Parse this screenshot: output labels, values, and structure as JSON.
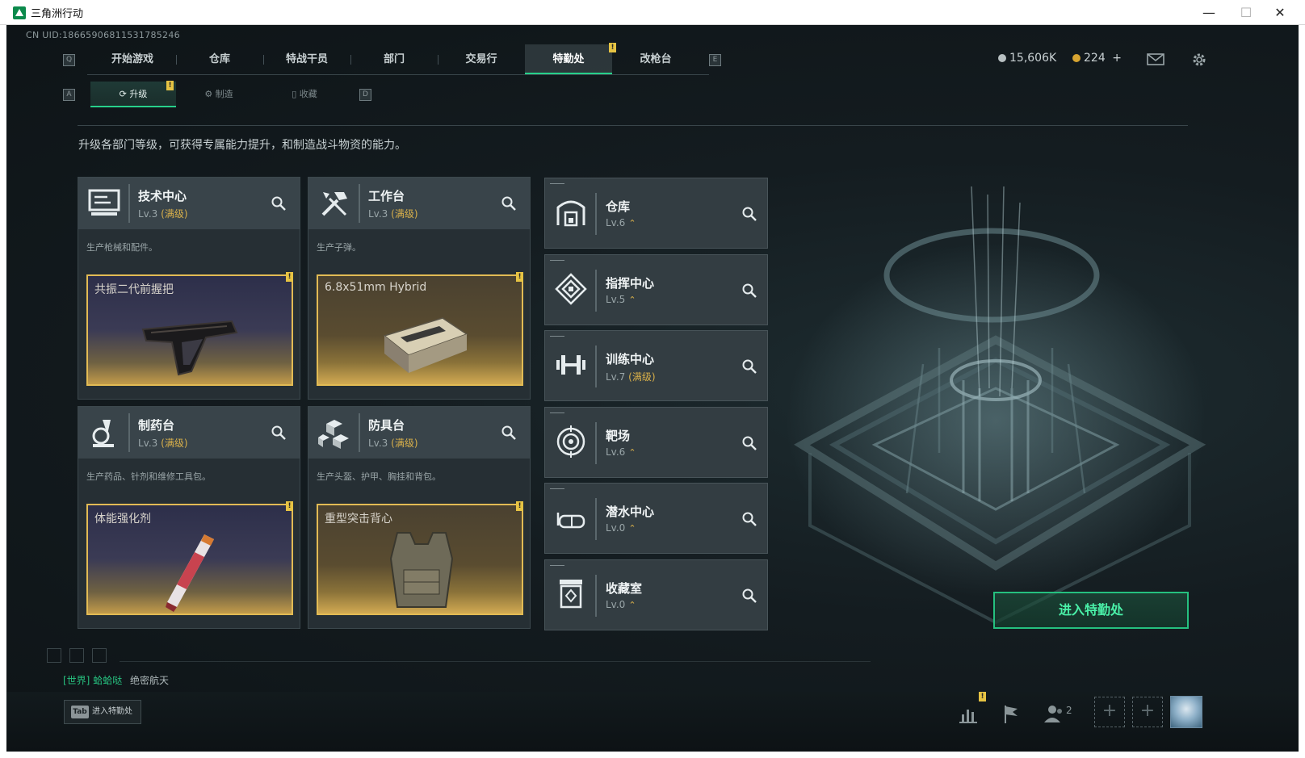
{
  "window": {
    "title": "三角洲行动",
    "controls": {
      "minimize": "—",
      "maximize": "☐",
      "close": "✕"
    }
  },
  "uid": "CN UID:18665906811531785246",
  "nav": {
    "key_left": "Q",
    "key_right": "E",
    "tabs": [
      {
        "label": "开始游戏"
      },
      {
        "label": "仓库"
      },
      {
        "label": "特战干员"
      },
      {
        "label": "部门"
      },
      {
        "label": "交易行"
      },
      {
        "label": "特勤处",
        "active": true
      },
      {
        "label": "改枪台"
      }
    ]
  },
  "currency": {
    "coins": "15,606K",
    "coins_color": "#b8c0c2",
    "tickets": "224",
    "tickets_color": "#d7a431",
    "tickets_add": "+"
  },
  "subtabs": {
    "key_left": "A",
    "key_right": "D",
    "items": [
      {
        "label": "升级",
        "active": true
      },
      {
        "label": "制造"
      },
      {
        "label": "收藏"
      }
    ]
  },
  "notice_mark": "!",
  "description": "升级各部门等级，可获得专属能力提升，和制造战斗物资的能力。",
  "cards": [
    {
      "name": "技术中心",
      "level": "Lv.3",
      "max": "(满级)",
      "desc": "生产枪械和配件。",
      "product": "共振二代前握把",
      "icon": "computer-icon",
      "product_icon": "foregrip-image"
    },
    {
      "name": "工作台",
      "level": "Lv.3",
      "max": "(满级)",
      "desc": "生产子弹。",
      "product": "6.8x51mm Hybrid",
      "icon": "tools-icon",
      "product_icon": "ammo-box-image"
    },
    {
      "name": "制药台",
      "level": "Lv.3",
      "max": "(满级)",
      "desc": "生产药品、针剂和维修工具包。",
      "product": "体能强化剂",
      "icon": "microscope-icon",
      "product_icon": "injector-image"
    },
    {
      "name": "防具台",
      "level": "Lv.3",
      "max": "(满级)",
      "desc": "生产头盔、护甲、胸挂和背包。",
      "product": "重型突击背心",
      "icon": "cubes-icon",
      "product_icon": "vest-image"
    }
  ],
  "side_cards": [
    {
      "name": "仓库",
      "level": "Lv.6",
      "up": "⌃",
      "icon": "storage-icon"
    },
    {
      "name": "指挥中心",
      "level": "Lv.5",
      "up": "⌃",
      "icon": "command-icon"
    },
    {
      "name": "训练中心",
      "level": "Lv.7",
      "max": "(满级)",
      "icon": "dumbbell-icon"
    },
    {
      "name": "靶场",
      "level": "Lv.6",
      "up": "⌃",
      "icon": "target-icon"
    },
    {
      "name": "潜水中心",
      "level": "Lv.0",
      "up": "⌃",
      "icon": "goggles-icon"
    },
    {
      "name": "收藏室",
      "level": "Lv.0",
      "up": "⌃",
      "icon": "collection-icon"
    }
  ],
  "enter_button": "进入特勤处",
  "chat": {
    "channel": "[世界]",
    "name": "蛤蛤哒",
    "message": "绝密航天"
  },
  "tab_hint": {
    "key": "Tab",
    "label": "进入特勤处"
  },
  "bottom": {
    "friends_count": "2",
    "slot_plus": "+"
  },
  "accent": "#27d08a",
  "gold": "#e2bb54"
}
